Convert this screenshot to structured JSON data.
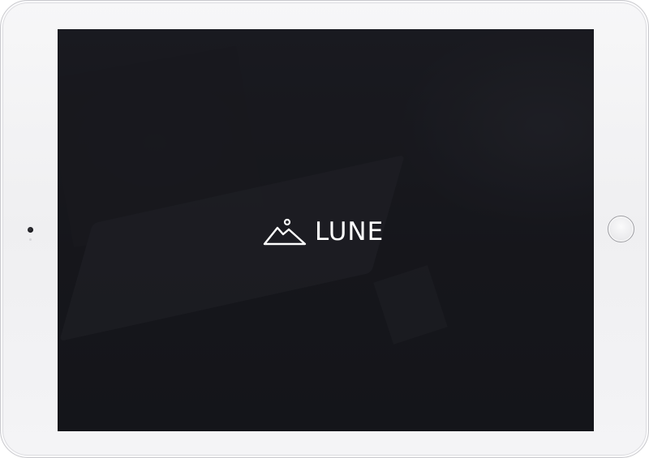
{
  "app": {
    "brand_name": "LUNE",
    "logo_icon": "mountain-sun-icon"
  },
  "device": {
    "type": "tablet",
    "buttons": [
      "home-button"
    ]
  },
  "colors": {
    "screen_background": "#1c1d22",
    "brand_text": "#ffffff",
    "device_frame": "#f2f2f4"
  }
}
